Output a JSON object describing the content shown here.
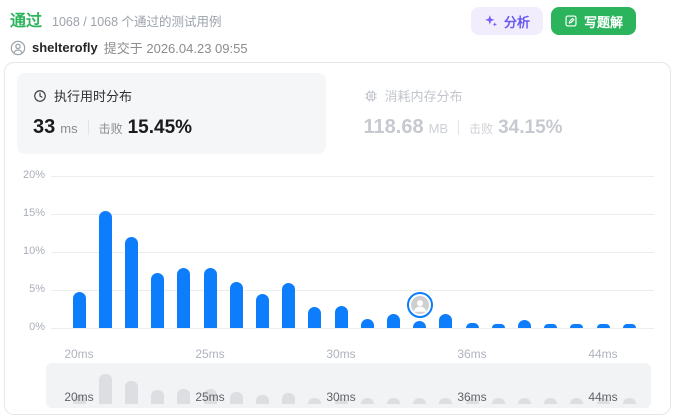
{
  "header": {
    "status": "通过",
    "passed_summary": "1068 / 1068 个通过的测试用例",
    "username": "shelterofly",
    "submitted_at": "提交于 2026.04.23 09:55",
    "buttons": {
      "analyze": "分析",
      "write_solution": "写题解"
    }
  },
  "stats": {
    "runtime": {
      "title": "执行用时分布",
      "value": "33",
      "unit": "ms",
      "beats_label": "击败",
      "beats_value": "15.45%",
      "selected": true
    },
    "memory": {
      "title": "消耗内存分布",
      "value": "118.68",
      "unit": "MB",
      "beats_label": "击败",
      "beats_value": "34.15%",
      "selected": false
    }
  },
  "chart_data": {
    "type": "bar",
    "title": "执行用时分布",
    "unit": "ms",
    "values_pct": [
      4.8,
      15.4,
      12.0,
      7.2,
      7.9,
      7.9,
      6.0,
      4.5,
      5.9,
      2.8,
      2.9,
      1.2,
      1.9,
      0.9,
      1.9,
      0.7,
      0.5,
      1.1,
      0.5,
      0.5,
      0.5,
      0.5
    ],
    "x_tick_indices": [
      0,
      5,
      10,
      15,
      20
    ],
    "x_tick_labels": [
      "20ms",
      "25ms",
      "30ms",
      "36ms",
      "44ms"
    ],
    "y_ticks": [
      {
        "label": "0%",
        "pct": 0
      },
      {
        "label": "5%",
        "pct": 5
      },
      {
        "label": "10%",
        "pct": 10
      },
      {
        "label": "15%",
        "pct": 15
      },
      {
        "label": "20%",
        "pct": 20
      }
    ],
    "ylim": [
      0,
      20
    ],
    "grid": true,
    "user_marker_index": 13,
    "bar_color": "#0d7dfc"
  },
  "minimap": {
    "labels": [
      "20ms",
      "25ms",
      "30ms",
      "36ms",
      "44ms"
    ],
    "label_indices": [
      0,
      5,
      10,
      15,
      20
    ]
  },
  "colors": {
    "accepted_green": "#2db55d",
    "solution_button_green": "#2bb45c",
    "bar_blue": "#0d7dfc",
    "analyze_purple": "#6a5af0"
  }
}
